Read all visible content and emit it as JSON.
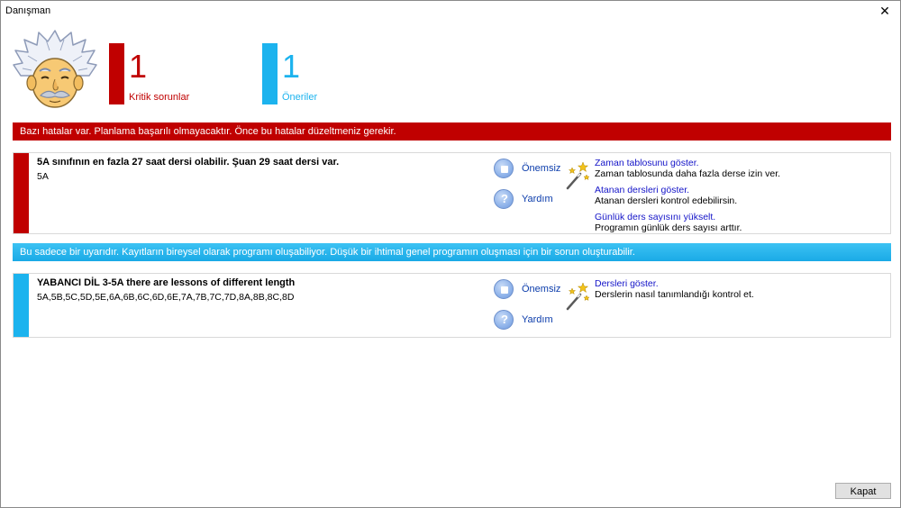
{
  "window": {
    "title": "Danışman"
  },
  "stats": {
    "critical": {
      "count": "1",
      "label": "Kritik sorunlar",
      "color": "#c00000"
    },
    "suggestions": {
      "count": "1",
      "label": "Öneriler",
      "color": "#1cb3ee"
    }
  },
  "error_banner": "Bazı hatalar var. Planlama başarılı olmayacaktır. Önce bu hatalar düzeltmeniz gerekir.",
  "error_card": {
    "title": "5A sınıfının en fazla 27 saat dersi olabilir. Şuan 29 saat dersi var.",
    "subtitle": "5A",
    "ignore_label": "Önemsiz",
    "help_label": "Yardım",
    "suggestions": [
      {
        "link": "Zaman tablosunu göster.",
        "desc": "Zaman tablosunda daha fazla derse izin ver."
      },
      {
        "link": "Atanan dersleri göster.",
        "desc": "Atanan dersleri kontrol edebilirsin."
      },
      {
        "link": "Günlük ders sayısını yükselt.",
        "desc": "Programın günlük ders sayısı arttır."
      }
    ]
  },
  "warning_banner": "Bu sadece bir uyarıdır. Kayıtların bireysel olarak programı oluşabiliyor. Düşük bir ihtimal genel programın oluşması için bir sorun oluşturabilir.",
  "warning_card": {
    "title": "YABANCI DİL 3-5A there are lessons of different length",
    "subtitle": "5A,5B,5C,5D,5E,6A,6B,6C,6D,6E,7A,7B,7C,7D,8A,8B,8C,8D",
    "ignore_label": "Önemsiz",
    "help_label": "Yardım",
    "suggestions": [
      {
        "link": "Dersleri göster.",
        "desc": "Derslerin nasıl tanımlandığı kontrol et."
      }
    ]
  },
  "footer": {
    "close_label": "Kapat"
  }
}
